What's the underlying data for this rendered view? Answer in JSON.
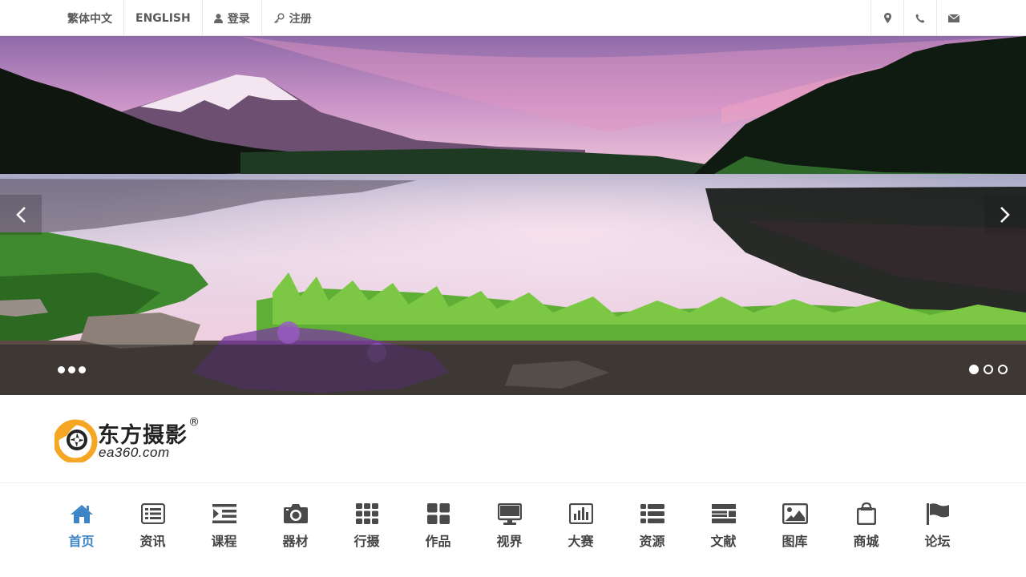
{
  "topbar": {
    "links": [
      {
        "label": "繁体中文",
        "icon": ""
      },
      {
        "label": "ENGLISH",
        "icon": ""
      },
      {
        "label": "登录",
        "icon": "user-icon"
      },
      {
        "label": "注册",
        "icon": "key-icon"
      }
    ],
    "icons": [
      "map-marker-icon",
      "phone-icon",
      "envelope-icon"
    ]
  },
  "banner": {
    "slide_count": 3,
    "active_slide": 1,
    "prev_icon": "chevron-left-icon",
    "next_icon": "chevron-right-icon"
  },
  "logo": {
    "name": "东方摄影",
    "domain": "ea360.com",
    "registered_mark": "®",
    "colors": {
      "orange": "#f5a623",
      "dark": "#222222"
    }
  },
  "nav": {
    "items": [
      {
        "label": "首页",
        "icon": "home-icon",
        "active": true
      },
      {
        "label": "资讯",
        "icon": "news-list-icon"
      },
      {
        "label": "课程",
        "icon": "indent-icon"
      },
      {
        "label": "器材",
        "icon": "camera-icon"
      },
      {
        "label": "行摄",
        "icon": "grid-icon"
      },
      {
        "label": "作品",
        "icon": "tiles-icon"
      },
      {
        "label": "视界",
        "icon": "monitor-icon"
      },
      {
        "label": "大赛",
        "icon": "bar-chart-icon"
      },
      {
        "label": "资源",
        "icon": "list-icon"
      },
      {
        "label": "文献",
        "icon": "document-icon"
      },
      {
        "label": "图库",
        "icon": "picture-icon"
      },
      {
        "label": "商城",
        "icon": "shopping-bag-icon"
      },
      {
        "label": "论坛",
        "icon": "flag-icon"
      }
    ],
    "active_color": "#3d85c6",
    "icon_color": "#4a4a4a"
  }
}
